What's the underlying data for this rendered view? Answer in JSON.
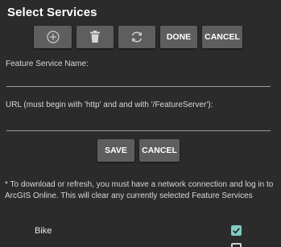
{
  "header": {
    "title": "Select Services"
  },
  "toolbar": {
    "add_icon": "plus-circle-icon",
    "delete_icon": "trash-icon",
    "refresh_icon": "refresh-icon",
    "done_label": "DONE",
    "cancel_label": "CANCEL"
  },
  "form": {
    "name_label": "Feature Service Name:",
    "name_value": "",
    "url_label": "URL (must begin with 'http' and and with '/FeatureServer'):",
    "url_value": "",
    "save_label": "SAVE",
    "cancel_label": "CANCEL"
  },
  "note": "* To download or refresh, you must have a network connection and log in to ArcGIS Online.  This will clear any currently selected Feature Services",
  "services": [
    {
      "label": "Bike",
      "checked": true
    },
    {
      "label": "",
      "checked": false
    }
  ],
  "colors": {
    "background": "#2b2b2b",
    "button": "#5e5e5e",
    "checkbox_accent": "#80cbc4"
  }
}
